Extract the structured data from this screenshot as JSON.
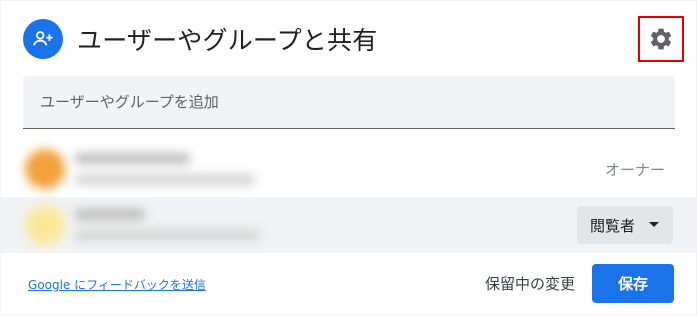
{
  "dialog": {
    "title": "ユーザーやグループと共有",
    "header_icon": "person-add-icon",
    "settings_icon": "gear-icon",
    "highlight_color": "#e00000"
  },
  "add_field": {
    "placeholder": "ユーザーやグループを追加",
    "value": ""
  },
  "people": [
    {
      "role": "オーナー",
      "avatar_color": "#f3a03a"
    },
    {
      "role": "閲覧者",
      "avatar_color": "#fae89a"
    }
  ],
  "footer": {
    "feedback_link": "Google にフィードバックを送信",
    "pending_changes": "保留中の変更",
    "save_label": "保存"
  },
  "colors": {
    "accent": "#1a73e8",
    "row_highlight": "#f1f3f4"
  }
}
